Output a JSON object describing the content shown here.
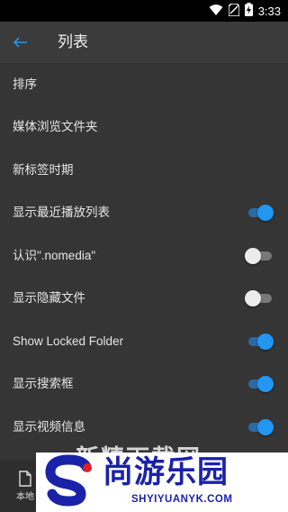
{
  "status_bar": {
    "time": "3:33"
  },
  "app_bar": {
    "title": "列表"
  },
  "settings": [
    {
      "label": "排序"
    },
    {
      "label": "媒体浏览文件夹"
    },
    {
      "label": "新标签时期"
    },
    {
      "label": "显示最近播放列表",
      "toggle": true
    },
    {
      "label": "认识\".nomedia\"",
      "toggle": false
    },
    {
      "label": "显示隐藏文件",
      "toggle": false
    },
    {
      "label": "Show Locked Folder",
      "toggle": true
    },
    {
      "label": "显示搜索框",
      "toggle": true
    },
    {
      "label": "显示视频信息",
      "toggle": true
    }
  ],
  "bottom_nav": {
    "local_label": "本地"
  },
  "watermark": {
    "faint_text": "新精下载网",
    "name": "尚游乐园",
    "url": "SHYIYUANYK.COM"
  },
  "colors": {
    "accent": "#2196f3",
    "background": "#353535",
    "app_bar": "#3b3b3b",
    "status_bar": "#000000",
    "watermark_text": "#1a22a8"
  }
}
